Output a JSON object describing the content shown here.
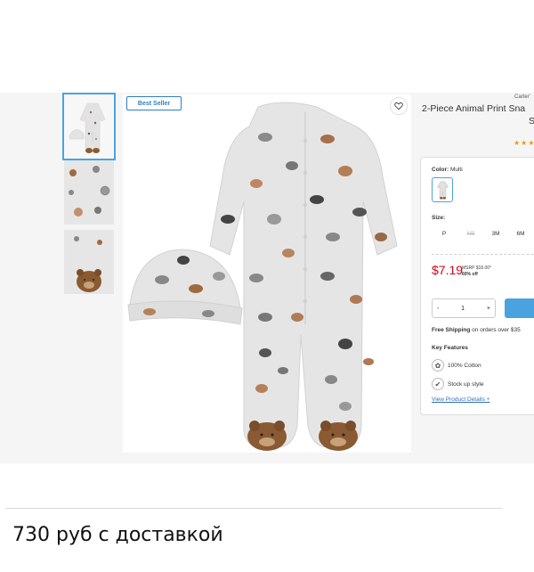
{
  "product": {
    "brand": "Carter'",
    "title_line1": "2-Piece Animal Print Sna",
    "title_line2": "S",
    "badge": "Best Seller",
    "rating_stars": "★★★"
  },
  "buybox": {
    "color_label": "Color:",
    "color_value": "Multi",
    "size_label": "Size:",
    "sizes": [
      "P",
      "NB",
      "3M",
      "6M"
    ],
    "price": "$7.19",
    "msrp": "MSRP $18.00*",
    "discount": "60% off",
    "qty_minus": "-",
    "qty_value": "1",
    "qty_plus": "+",
    "shipping_bold": "Free Shipping",
    "shipping_rest": "on orders over $35",
    "key_features_label": "Key Features",
    "features": [
      "100% Cotton",
      "Stock up style"
    ],
    "view_details": "View Product Details",
    "view_details_plus": "+"
  },
  "caption": "730 руб с доставкой",
  "colors": {
    "accent": "#4aa3df",
    "price_red": "#d0021b",
    "badge_blue": "#2f7cc4",
    "fabric": "#e4e4e4",
    "bear_brown": "#8a5a33"
  }
}
